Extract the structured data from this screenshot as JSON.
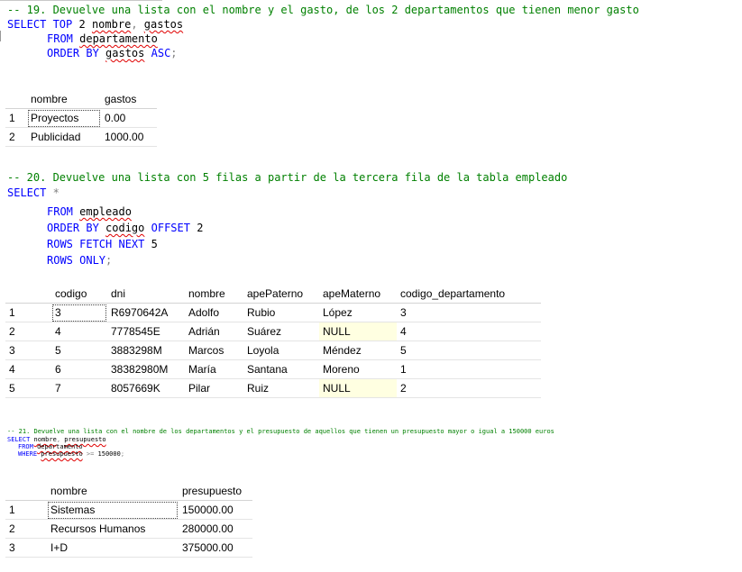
{
  "q19": {
    "comment": "-- 19. Devuelve una lista con el nombre y el gasto, de los 2 departamentos que tienen menor gasto",
    "l1_kw": "SELECT TOP ",
    "l1_num": "2",
    "l1_a": " ",
    "l1_col1": "nombre",
    "l1_comma": ", ",
    "l1_col2": "gastos",
    "l2_kw": "FROM ",
    "l2_tbl": "departamento",
    "l3_kw": "ORDER BY ",
    "l3_col": "gastos",
    "l3_kw2": " ASC",
    "l3_end": ";",
    "columns": [
      "nombre",
      "gastos"
    ],
    "rows": [
      {
        "n": "1",
        "nombre": "Proyectos",
        "gastos": "0.00"
      },
      {
        "n": "2",
        "nombre": "Publicidad",
        "gastos": "1000.00"
      }
    ]
  },
  "q20": {
    "comment": "-- 20. Devuelve una lista con 5 filas a partir de la tercera fila de la tabla empleado",
    "l1_kw": "SELECT ",
    "l1_star": "*",
    "l2_kw": "FROM ",
    "l2_tbl": "empleado",
    "l3_kw": "ORDER BY ",
    "l3_col": "codigo",
    "l3_kw2": " OFFSET ",
    "l3_num": "2",
    "l4_kw": "ROWS FETCH NEXT ",
    "l4_num": "5",
    "l5_kw": "ROWS ONLY",
    "l5_end": ";",
    "columns": [
      "codigo",
      "dni",
      "nombre",
      "apePaterno",
      "apeMaterno",
      "codigo_departamento"
    ],
    "rows": [
      {
        "n": "1",
        "codigo": "3",
        "dni": "R6970642A",
        "nombre": "Adolfo",
        "apePaterno": "Rubio",
        "apeMaterno": "López",
        "codigo_departamento": "3"
      },
      {
        "n": "2",
        "codigo": "4",
        "dni": "7778545E",
        "nombre": "Adrián",
        "apePaterno": "Suárez",
        "apeMaterno": "NULL",
        "codigo_departamento": "4"
      },
      {
        "n": "3",
        "codigo": "5",
        "dni": "3883298M",
        "nombre": "Marcos",
        "apePaterno": "Loyola",
        "apeMaterno": "Méndez",
        "codigo_departamento": "5"
      },
      {
        "n": "4",
        "codigo": "6",
        "dni": "38382980M",
        "nombre": "María",
        "apePaterno": "Santana",
        "apeMaterno": "Moreno",
        "codigo_departamento": "1"
      },
      {
        "n": "5",
        "codigo": "7",
        "dni": "8057669K",
        "nombre": "Pilar",
        "apePaterno": "Ruiz",
        "apeMaterno": "NULL",
        "codigo_departamento": "2"
      }
    ]
  },
  "q21": {
    "comment": "-- 21. Devuelve una lista con el nombre de los departamentos y el presupuesto de aquellos que tienen un presupuesto mayor o igual a 150000 euros",
    "l1_kw": "SELECT ",
    "l1_col1": "nombre",
    "l1_comma": ", ",
    "l1_col2": "presupuesto",
    "l2_kw": "FROM ",
    "l2_tbl": "departamento",
    "l3_kw": "WHERE ",
    "l3_col": "presupuesto",
    "l3_op": " >= ",
    "l3_num": "150000",
    "l3_end": ";",
    "columns": [
      "nombre",
      "presupuesto"
    ],
    "rows": [
      {
        "n": "1",
        "nombre": "Sistemas",
        "presupuesto": "150000.00"
      },
      {
        "n": "2",
        "nombre": "Recursos Humanos",
        "presupuesto": "280000.00"
      },
      {
        "n": "3",
        "nombre": "I+D",
        "presupuesto": "375000.00"
      }
    ]
  },
  "colors": {
    "keyword": "#0000ff",
    "comment": "#008000",
    "null_bg": "#ffffe1",
    "squiggle": "#e00000"
  }
}
